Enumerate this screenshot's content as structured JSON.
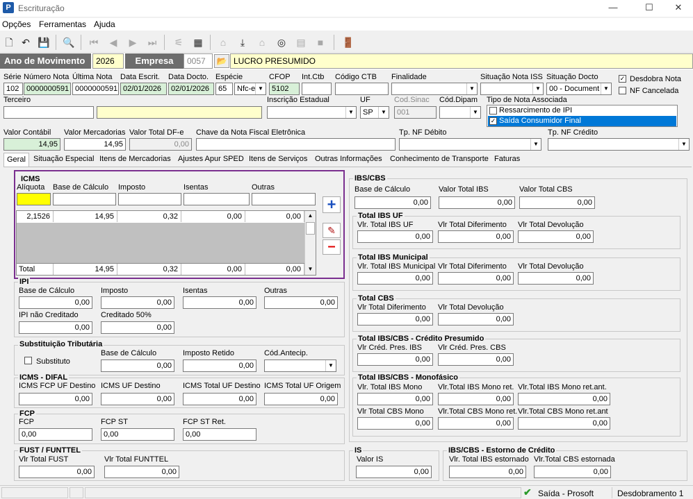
{
  "window": {
    "title": "Escrituração",
    "icon": "P",
    "min": "—",
    "max": "☐",
    "close": "✕"
  },
  "menu": [
    "Opções",
    "Ferramentas",
    "Ajuda"
  ],
  "header": {
    "ano_label": "Ano de Movimento",
    "ano": "2026",
    "empresa_label": "Empresa",
    "empresa_code": "0057",
    "empresa_name": "LUCRO PRESUMIDO"
  },
  "fields": {
    "serie_l": "Série",
    "serie": "102",
    "num_l": "Número Nota",
    "num": "0000000591",
    "ult_l": "Última Nota",
    "ult": "0000000591",
    "escr_l": "Data Escrit.",
    "escr": "02/01/2026",
    "docto_l": "Data Docto.",
    "docto": "02/01/2026",
    "esp_l": "Espécie",
    "esp_code": "65",
    "esp": "Nfc-e",
    "cfop_l": "CFOP",
    "cfop": "5102",
    "intctb_l": "Int.Ctb",
    "codctb_l": "Código CTB",
    "fin_l": "Finalidade",
    "sitiss_l": "Situação Nota ISS",
    "sitdoc_l": "Situação Docto",
    "sitdoc": "00 - Document",
    "desdobra_l": "Desdobra Nota",
    "nfcanc_l": "NF Cancelada",
    "terc_l": "Terceiro",
    "ie_l": "Inscrição Estadual",
    "uf_l": "UF",
    "uf": "SP",
    "sinac_l": "Cod.Sinac",
    "sinac": "001",
    "dipam_l": "Cód.Dipam",
    "tipo_l": "Tipo de Nota Associada",
    "tipo_opt1": "Ressarcimento de IPI",
    "tipo_opt2": "Saída Consumidor Final",
    "vcont_l": "Valor Contábil",
    "vcont": "14,95",
    "vmerc_l": "Valor Mercadorias",
    "vmerc": "14,95",
    "vdfe_l": "Valor Total DF-e",
    "vdfe": "0,00",
    "chave_l": "Chave da Nota Fiscal Eletrônica",
    "tpdeb_l": "Tp. NF Débito",
    "tpcred_l": "Tp. NF Crédito"
  },
  "tabs": [
    "Geral",
    "Situação Especial",
    "Itens de Mercadorias",
    "Ajustes Apur SPED",
    "Itens de Serviços",
    "Outras Informações",
    "Conhecimento de Transporte",
    "Faturas"
  ],
  "icms": {
    "title": "ICMS",
    "cols": [
      "Alíquota",
      "Base de Cálculo",
      "Imposto",
      "Isentas",
      "Outras"
    ],
    "row": [
      "2,1526",
      "14,95",
      "0,32",
      "0,00",
      "0,00"
    ],
    "total": [
      "Total",
      "14,95",
      "0,32",
      "0,00",
      "0,00"
    ]
  },
  "ipi": {
    "title": "IPI",
    "bc_l": "Base de Cálculo",
    "bc": "0,00",
    "imp_l": "Imposto",
    "imp": "0,00",
    "ise_l": "Isentas",
    "ise": "0,00",
    "out_l": "Outras",
    "out": "0,00",
    "nc_l": "IPI não Creditado",
    "nc": "0,00",
    "c50_l": "Creditado 50%",
    "c50": "0,00"
  },
  "st": {
    "title": "Substituição Tributária",
    "subst_l": "Substituto",
    "bc_l": "Base de Cálculo",
    "bc": "0,00",
    "ret_l": "Imposto Retido",
    "ret": "0,00",
    "ant_l": "Cód.Antecip."
  },
  "difal": {
    "title": "ICMS - DIFAL",
    "fcp_l": "ICMS FCP UF Destino",
    "fcp": "0,00",
    "ufd_l": "ICMS UF Destino",
    "ufd": "0,00",
    "tufd_l": "ICMS Total UF Destino",
    "tufd": "0,00",
    "tufo_l": "ICMS Total UF Origem",
    "tufo": "0,00"
  },
  "fcp": {
    "title": "FCP",
    "fcp_l": "FCP",
    "fcp": "0,00",
    "st_l": "FCP ST",
    "st": "0,00",
    "ret_l": "FCP ST Ret.",
    "ret": "0,00"
  },
  "fust": {
    "title": "FUST / FUNTTEL",
    "fust_l": "Vlr Total FUST",
    "fust": "0,00",
    "funt_l": "Vlr Total FUNTTEL",
    "funt": "0,00"
  },
  "ibscbs": {
    "title": "IBS/CBS",
    "bc_l": "Base de Cálculo",
    "bc": "0,00",
    "ibs_l": "Valor Total IBS",
    "ibs": "0,00",
    "cbs_l": "Valor Total CBS",
    "cbs": "0,00"
  },
  "ibsuf": {
    "title": "Total IBS UF",
    "a_l": "Vlr. Total IBS UF",
    "a": "0,00",
    "b_l": "Vlr Total Diferimento",
    "b": "0,00",
    "c_l": "Vlr Total Devolução",
    "c": "0,00"
  },
  "ibsmun": {
    "title": "Total IBS Municipal",
    "a_l": "Vlr. Total IBS Municipal",
    "a": "0,00",
    "b_l": "Vlr Total Diferimento",
    "b": "0,00",
    "c_l": "Vlr Total Devolução",
    "c": "0,00"
  },
  "cbs": {
    "title": "Total CBS",
    "a_l": "Vlr Total Diferimento",
    "a": "0,00",
    "b_l": "Vlr Total Devolução",
    "b": "0,00"
  },
  "cpres": {
    "title": "Total IBS/CBS - Crédito Presumido",
    "a_l": "Vlr Créd. Pres. IBS",
    "a": "0,00",
    "b_l": "Vlr Créd. Pres. CBS",
    "b": "0,00"
  },
  "mono": {
    "title": "Total IBS/CBS - Monofásico",
    "a_l": "Vlr. Total IBS Mono",
    "a": "0,00",
    "b_l": "Vlr.Total IBS Mono ret.",
    "b": "0,00",
    "c_l": "Vlr.Total IBS Mono ret.ant.",
    "c": "0,00",
    "d_l": "Vlr Total CBS Mono",
    "d": "0,00",
    "e_l": "Vlr.Total CBS Mono ret.",
    "e": "0,00",
    "f_l": "Vlr.Total CBS Mono ret.ant",
    "f": "0,00"
  },
  "is": {
    "title": "IS",
    "a_l": "Valor IS",
    "a": "0,00"
  },
  "estorno": {
    "title": "IBS/CBS - Estorno de Crédito",
    "a_l": "Vlr. Total IBS estornado",
    "a": "0,00",
    "b_l": "Vlr.Total CBS estornada",
    "b": "0,00"
  },
  "status": {
    "mode": "Saída - Prosoft",
    "desd": "Desdobramento 1"
  }
}
